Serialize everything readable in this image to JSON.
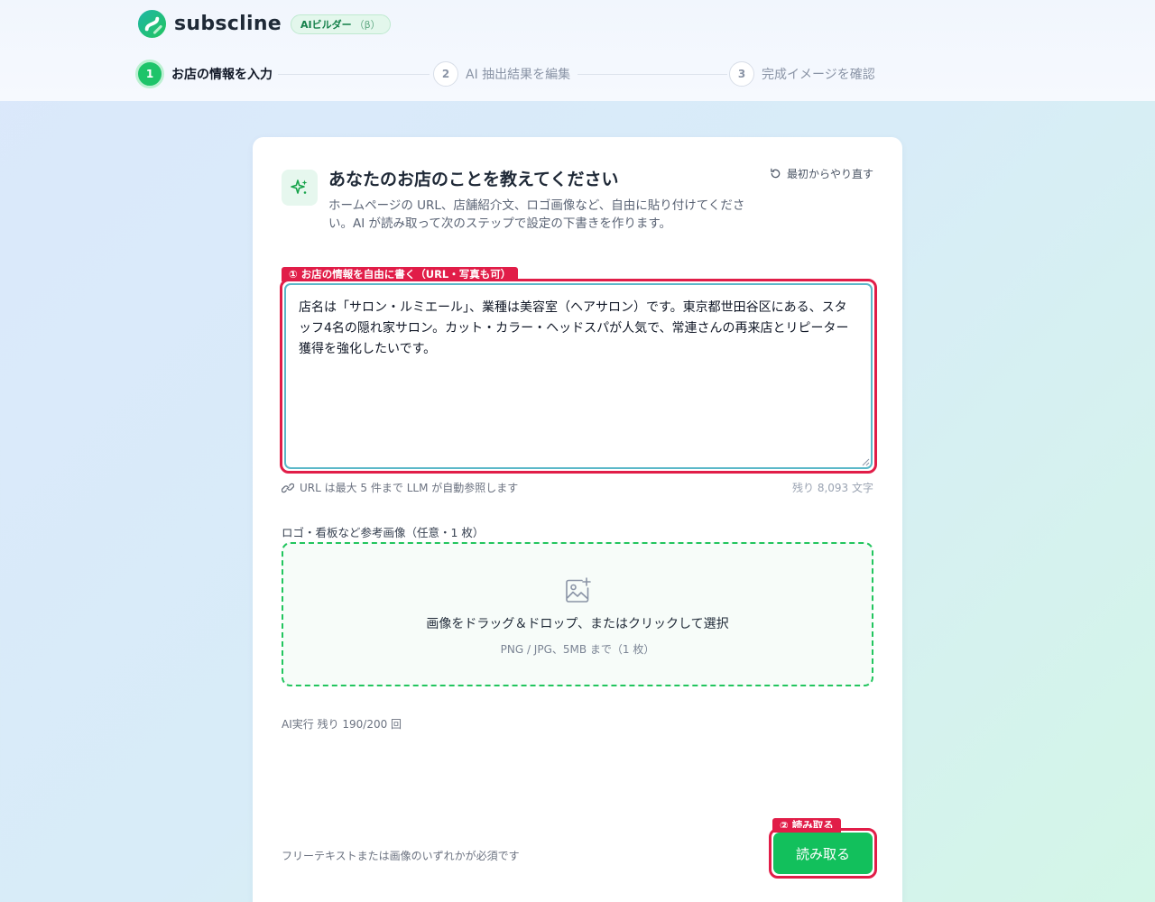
{
  "header": {
    "logo_text": "subscline",
    "badge_label": "AIビルダー",
    "badge_beta": "（β）"
  },
  "stepper": {
    "steps": [
      {
        "num": "1",
        "label": "お店の情報を入力",
        "active": true
      },
      {
        "num": "2",
        "label": "AI 抽出結果を編集",
        "active": false
      },
      {
        "num": "3",
        "label": "完成イメージを確認",
        "active": false
      }
    ]
  },
  "card": {
    "title": "あなたのお店のことを教えてください",
    "subtitle": "ホームページの URL、店舗紹介文、ロゴ画像など、自由に貼り付けてください。AI が読み取って次のステップで設定の下書きを作ります。",
    "reset_label": "最初からやり直す",
    "text_field": {
      "annotation": "① お店の情報を自由に書く（URL・写真も可）",
      "value": "店名は「サロン・ルミエール」、業種は美容室（ヘアサロン）です。東京都世田谷区にある、スタッフ4名の隠れ家サロン。カット・カラー・ヘッドスパが人気で、常連さんの再来店とリピーター獲得を強化したいです。",
      "helper": "URL は最大 5 件まで LLM が自動参照します",
      "remaining": "残り 8,093 文字"
    },
    "image_field": {
      "label": "ロゴ・看板など参考画像（任意・1 枚）",
      "drop_text": "画像をドラッグ＆ドロップ、またはクリックして選択",
      "drop_sub": "PNG / JPG、5MB まで（1 枚）"
    },
    "ai_remaining": "AI実行 残り 190/200 回",
    "footer_note": "フリーテキストまたは画像のいずれかが必須です",
    "submit": {
      "annotation": "② 読み取る",
      "label": "読み取る"
    }
  },
  "colors": {
    "brand_green": "#12c05c",
    "annotation_red": "#e11d48",
    "focus_teal": "#5bb8c9"
  }
}
